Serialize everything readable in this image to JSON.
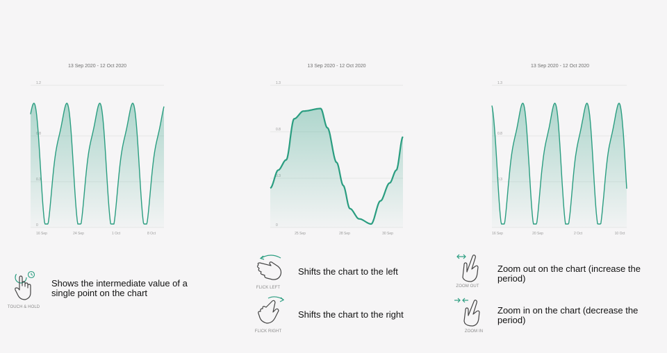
{
  "chart_data": [
    {
      "type": "area",
      "title": "13 Sep 2020 - 12 Oct 2020",
      "y_tick_labels": [
        "1.2",
        "0.8",
        "0.3",
        "0"
      ],
      "x_tick_labels": [
        "16 Sep",
        "24 Sep",
        "1 Oct",
        "8 Oct"
      ],
      "grid": true,
      "series_color": "#2a9d80"
    },
    {
      "type": "area",
      "title": "13 Sep 2020 - 12 Oct 2020",
      "y_tick_labels": [
        "1.3",
        "0.8",
        "0.3",
        "0"
      ],
      "x_tick_labels": [
        "25 Sep",
        "28 Sep",
        "30 Sep"
      ],
      "grid": true,
      "series_color": "#2a9d80"
    },
    {
      "type": "area",
      "title": "13 Sep 2020 - 12 Oct 2020",
      "y_tick_labels": [
        "1.3",
        "0.8",
        "0.3"
      ],
      "x_tick_labels": [
        "16 Sep",
        "20 Sep",
        "2 Oct",
        "10 Oct"
      ],
      "grid": true,
      "series_color": "#2a9d80"
    }
  ],
  "gestures": {
    "touch_hold": {
      "caption": "TOUCH & HOLD",
      "description": "Shows the intermediate value of a single point on the chart",
      "icon": "touch-hold-icon"
    },
    "flick_left": {
      "caption": "FLICK LEFT",
      "description": "Shifts the chart to the left",
      "icon": "flick-left-icon"
    },
    "flick_right": {
      "caption": "FLICK RIGHT",
      "description": "Shifts the chart to the right",
      "icon": "flick-right-icon"
    },
    "zoom_out": {
      "caption": "ZOOM OUT",
      "description": "Zoom out on the chart (increase the period)",
      "icon": "zoom-out-icon"
    },
    "zoom_in": {
      "caption": "ZOOM IN",
      "description": "Zoom in on the chart (decrease the period)",
      "icon": "zoom-in-icon"
    }
  },
  "colors": {
    "accent": "#2a9d80",
    "icon_stroke": "#444444",
    "arrow": "#2a9d80"
  }
}
